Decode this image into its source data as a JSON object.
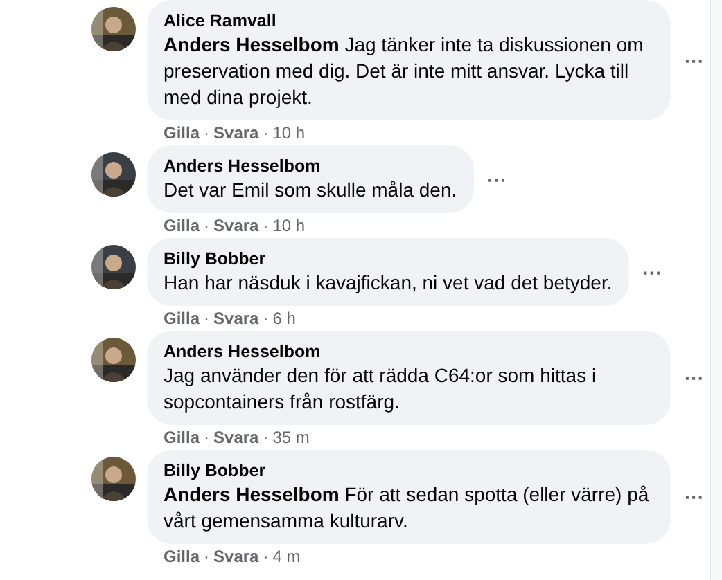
{
  "comments": [
    {
      "author": "Alice Ramvall",
      "text": "**Anders Hesselbom** Jag tänker inte ta diskussionen om preservation med dig. Det är inte mitt ansvar. Lycka till med dina projekt.",
      "more": "···",
      "actions": [
        "Gilla",
        "Svara"
      ],
      "separators": [
        "·",
        "·"
      ],
      "time": "10 h"
    },
    {
      "author": "Anders Hesselbom",
      "text": "Det var Emil som skulle måla den.",
      "more": "···",
      "actions": [
        "Gilla",
        "Svara"
      ],
      "separators": [
        "·",
        "·"
      ],
      "time": "10 h"
    },
    {
      "author": "Billy Bobber",
      "text": "Han har näsduk i kavajfickan, ni vet vad det betyder.",
      "more": "···",
      "actions": [
        "Gilla",
        "Svara"
      ],
      "separators": [
        "·",
        "·"
      ],
      "time": "6 h"
    },
    {
      "author": "Anders Hesselbom",
      "text": "Jag använder den för att rädda C64:or som hittas i sopcontainers från rostfärg.",
      "more": "···",
      "actions": [
        "Gilla",
        "Svara"
      ],
      "separators": [
        "·",
        "·"
      ],
      "time": "35 m"
    },
    {
      "author": "Billy Bobber",
      "text": "**Anders Hesselbom** För att sedan spotta (eller värre) på vårt gemensamma kulturarv.",
      "more": "···",
      "actions": [
        "Gilla",
        "Svara"
      ],
      "separators": [
        "·",
        "·"
      ],
      "time": "4 m"
    }
  ]
}
